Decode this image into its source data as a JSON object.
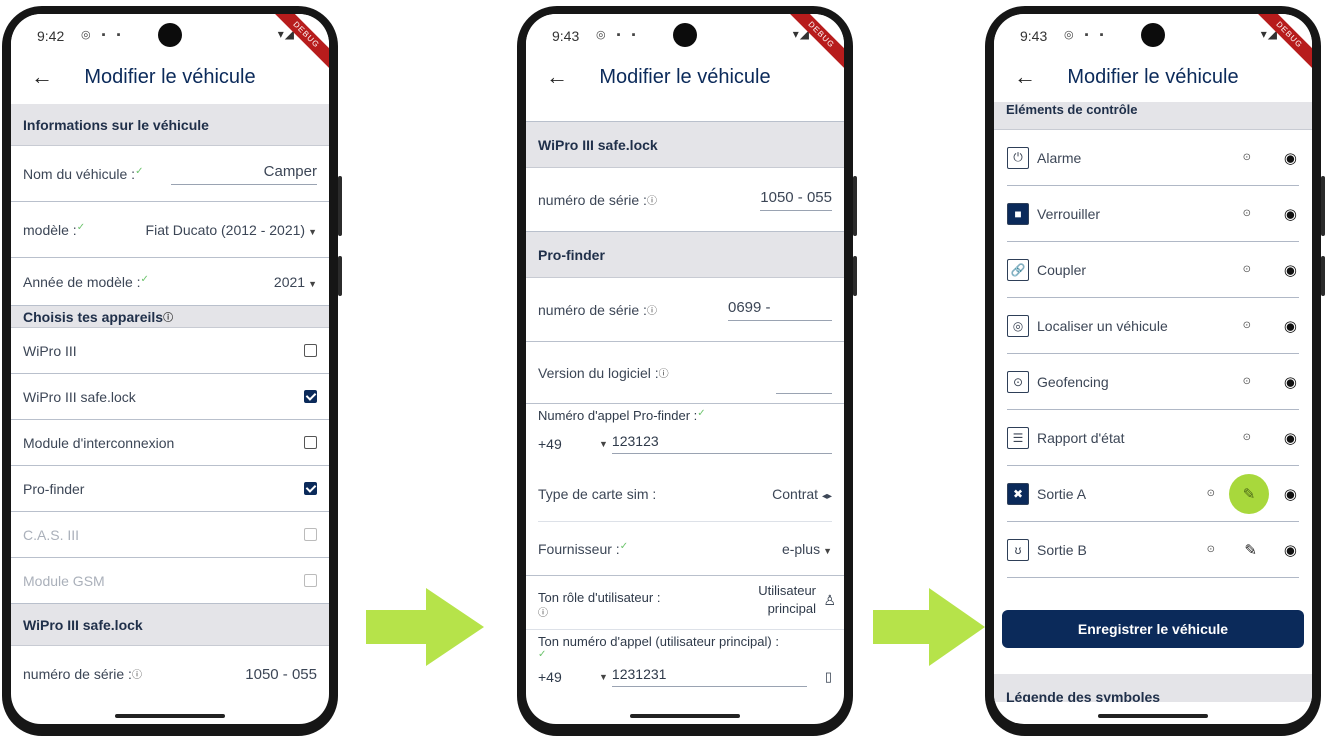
{
  "phone1": {
    "time": "9:42",
    "title": "Modifier le véhicule",
    "section_info": "Informations sur le véhicule",
    "name_label": "Nom du véhicule :",
    "name_value": "Camper",
    "model_label": "modèle :",
    "model_value": "Fiat Ducato (2012 - 2021)",
    "year_label": "Année de modèle :",
    "year_value": "2021",
    "section_devices": "Choisis tes appareils",
    "devices": [
      {
        "label": "WiPro III",
        "checked": false,
        "disabled": false
      },
      {
        "label": "WiPro III safe.lock",
        "checked": true,
        "disabled": false
      },
      {
        "label": "Module d'interconnexion",
        "checked": false,
        "disabled": false
      },
      {
        "label": "Pro-finder",
        "checked": true,
        "disabled": false
      },
      {
        "label": "C.A.S. III",
        "checked": false,
        "disabled": true
      },
      {
        "label": "Module GSM",
        "checked": false,
        "disabled": true
      }
    ],
    "section_safelock": "WiPro III safe.lock",
    "serial_label": "numéro de série :",
    "serial_value": "1050 - 055"
  },
  "phone2": {
    "time": "9:43",
    "title": "Modifier le véhicule",
    "section_safelock": "WiPro III safe.lock",
    "serial_label": "numéro de série :",
    "serial_value": "1050 - 055",
    "section_profinder": "Pro-finder",
    "pf_serial_label": "numéro de série :",
    "pf_serial_value": "0699 -",
    "software_label": "Version du logiciel :",
    "call_label": "Numéro d'appel Pro-finder :",
    "call_prefix": "+49",
    "call_number": "123123",
    "sim_label": "Type de carte sim :",
    "sim_value": "Contrat",
    "provider_label": "Fournisseur :",
    "provider_value": "e-plus",
    "role_label": "Ton rôle d'utilisateur :",
    "role_value_1": "Utilisateur",
    "role_value_2": "principal",
    "own_call_label": "Ton numéro d'appel (utilisateur principal) :",
    "own_prefix": "+49",
    "own_number": "1231231"
  },
  "phone3": {
    "time": "9:43",
    "title": "Modifier le véhicule",
    "section_controls": "Eléments de contrôle",
    "controls": [
      {
        "label": "Alarme",
        "icon": "power-icon"
      },
      {
        "label": "Verrouiller",
        "icon": "lock-icon"
      },
      {
        "label": "Coupler",
        "icon": "link-icon"
      },
      {
        "label": "Localiser un véhicule",
        "icon": "locate-icon"
      },
      {
        "label": "Geofencing",
        "icon": "geofence-pin-icon"
      },
      {
        "label": "Rapport d'état",
        "icon": "status-report-icon"
      },
      {
        "label": "Sortie A",
        "icon": "fan-icon"
      },
      {
        "label": "Sortie B",
        "icon": "output-b-icon"
      }
    ],
    "save_button": "Enregistrer le véhicule",
    "section_legend": "Légende des symboles"
  },
  "colors": {
    "primary": "#0b2a5a",
    "section_bg": "#e4e4e8",
    "accent_arrow": "#b6e34a",
    "check_green": "#6ec46e",
    "highlight": "#a8d83c"
  }
}
